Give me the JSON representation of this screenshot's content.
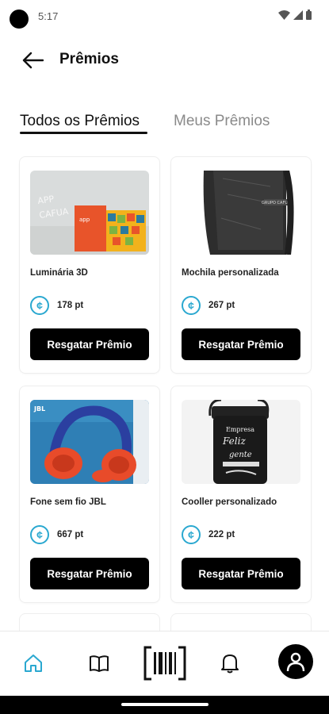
{
  "status_bar": {
    "time": "5:17"
  },
  "header": {
    "title": "Prêmios"
  },
  "tabs": [
    {
      "label": "Todos os Prêmios",
      "active": true
    },
    {
      "label": "Meus Prêmios",
      "active": false
    }
  ],
  "colors": {
    "accent_coin": "#2aa8d0",
    "button_bg": "#000000",
    "active_nav": "#2aa8d0"
  },
  "rewards": [
    {
      "name": "Luminária 3D",
      "points": "178 pt",
      "button_label": "Resgatar Prêmio",
      "image_text_1": "APP",
      "image_text_2": "CAFUA",
      "image_text_3": "app"
    },
    {
      "name": "Mochila personalizada",
      "points": "267 pt",
      "button_label": "Resgatar Prêmio",
      "image_text_1": "GRUPO CAFUA"
    },
    {
      "name": "Fone sem fio JBL",
      "points": "667 pt",
      "button_label": "Resgatar Prêmio",
      "image_text_1": "JBL"
    },
    {
      "name": "Cooller personalizado",
      "points": "222 pt",
      "button_label": "Resgatar Prêmio",
      "image_text_1": "Empresa",
      "image_text_2": "Feliz",
      "image_text_3": "gente"
    }
  ],
  "bottom_nav": [
    {
      "icon": "home-icon",
      "active": true
    },
    {
      "icon": "book-icon",
      "active": false
    },
    {
      "icon": "barcode-scan-icon",
      "active": false
    },
    {
      "icon": "bell-icon",
      "active": false
    },
    {
      "icon": "profile-icon",
      "active": false
    }
  ]
}
